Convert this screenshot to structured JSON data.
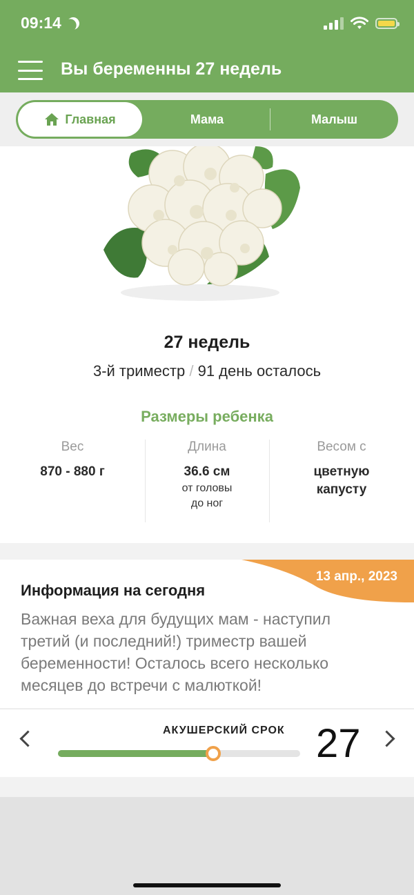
{
  "status_bar": {
    "time": "09:14"
  },
  "header": {
    "title": "Вы беременны 27 недель"
  },
  "tabs": [
    {
      "label": "Главная",
      "active": true
    },
    {
      "label": "Мама",
      "active": false
    },
    {
      "label": "Малыш",
      "active": false
    }
  ],
  "week": {
    "title": "27 недель",
    "trimester": "3-й триместр",
    "separator": "/",
    "days_left": "91 день осталось"
  },
  "baby_size": {
    "title": "Размеры ребенка",
    "weight": {
      "label": "Вес",
      "value": "870 - 880 г"
    },
    "length": {
      "label": "Длина",
      "value": "36.6 см",
      "note_line1": "от головы",
      "note_line2": "до ног"
    },
    "compare": {
      "label": "Весом с",
      "value_line1": "цветную",
      "value_line2": "капусту"
    }
  },
  "info": {
    "date": "13 апр., 2023",
    "title": "Информация на сегодня",
    "text": "Важная веха для будущих мам - наступил третий (и последний!) триместр вашей беременности! Осталось всего несколько месяцев до встречи с малюткой!"
  },
  "term": {
    "label": "АКУШЕРСКИЙ СРОК",
    "week": "27",
    "progress_fraction": 0.64
  },
  "colors": {
    "brand_green": "#75ac5e",
    "accent_orange": "#f0a14a"
  }
}
